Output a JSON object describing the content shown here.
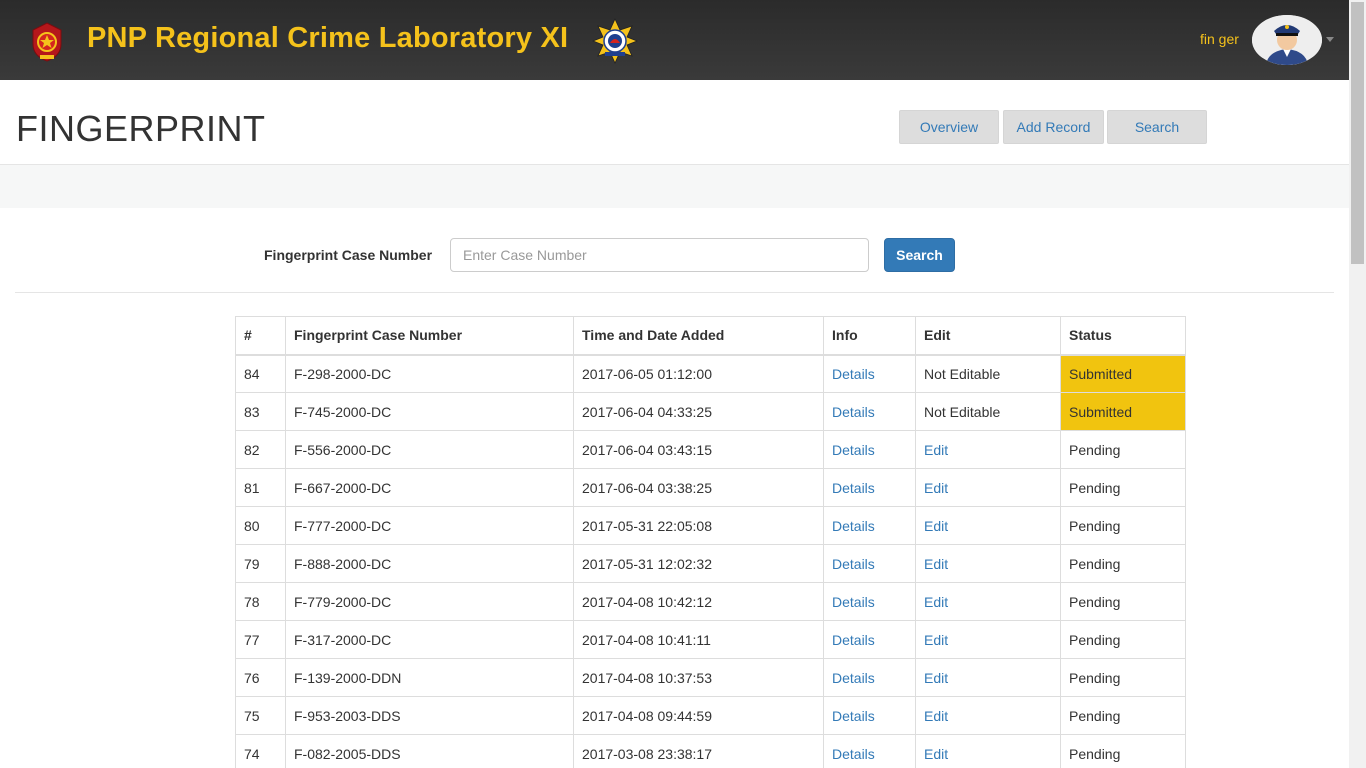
{
  "header": {
    "title": "PNP Regional Crime Laboratory XI",
    "user_name": "fin ger",
    "left_logo_icon": "pnp-badge-icon",
    "right_logo_icon": "crime-lab-star-badge-icon",
    "avatar_icon": "police-officer-avatar-icon",
    "accent_color": "#f5c21b"
  },
  "page": {
    "title": "FINGERPRINT"
  },
  "nav": {
    "overview": "Overview",
    "add_record": "Add Record",
    "search": "Search"
  },
  "search_form": {
    "label": "Fingerprint Case Number",
    "placeholder": "Enter Case Number",
    "button": "Search"
  },
  "table": {
    "headers": [
      "#",
      "Fingerprint Case Number",
      "Time and Date Added",
      "Info",
      "Edit",
      "Status"
    ],
    "rows": [
      {
        "num": "84",
        "case": "F-298-2000-DC",
        "added": "2017-06-05 01:12:00",
        "info": "Details",
        "edit": "Not Editable",
        "editable": false,
        "status": "Submitted"
      },
      {
        "num": "83",
        "case": "F-745-2000-DC",
        "added": "2017-06-04 04:33:25",
        "info": "Details",
        "edit": "Not Editable",
        "editable": false,
        "status": "Submitted"
      },
      {
        "num": "82",
        "case": "F-556-2000-DC",
        "added": "2017-06-04 03:43:15",
        "info": "Details",
        "edit": "Edit",
        "editable": true,
        "status": "Pending"
      },
      {
        "num": "81",
        "case": "F-667-2000-DC",
        "added": "2017-06-04 03:38:25",
        "info": "Details",
        "edit": "Edit",
        "editable": true,
        "status": "Pending"
      },
      {
        "num": "80",
        "case": "F-777-2000-DC",
        "added": "2017-05-31 22:05:08",
        "info": "Details",
        "edit": "Edit",
        "editable": true,
        "status": "Pending"
      },
      {
        "num": "79",
        "case": "F-888-2000-DC",
        "added": "2017-05-31 12:02:32",
        "info": "Details",
        "edit": "Edit",
        "editable": true,
        "status": "Pending"
      },
      {
        "num": "78",
        "case": "F-779-2000-DC",
        "added": "2017-04-08 10:42:12",
        "info": "Details",
        "edit": "Edit",
        "editable": true,
        "status": "Pending"
      },
      {
        "num": "77",
        "case": "F-317-2000-DC",
        "added": "2017-04-08 10:41:11",
        "info": "Details",
        "edit": "Edit",
        "editable": true,
        "status": "Pending"
      },
      {
        "num": "76",
        "case": "F-139-2000-DDN",
        "added": "2017-04-08 10:37:53",
        "info": "Details",
        "edit": "Edit",
        "editable": true,
        "status": "Pending"
      },
      {
        "num": "75",
        "case": "F-953-2003-DDS",
        "added": "2017-04-08 09:44:59",
        "info": "Details",
        "edit": "Edit",
        "editable": true,
        "status": "Pending"
      },
      {
        "num": "74",
        "case": "F-082-2005-DDS",
        "added": "2017-03-08 23:38:17",
        "info": "Details",
        "edit": "Edit",
        "editable": true,
        "status": "Pending"
      }
    ]
  },
  "colors": {
    "submitted_status": "#f1c40f",
    "link": "#337ab7",
    "primary_button": "#337ab7"
  }
}
